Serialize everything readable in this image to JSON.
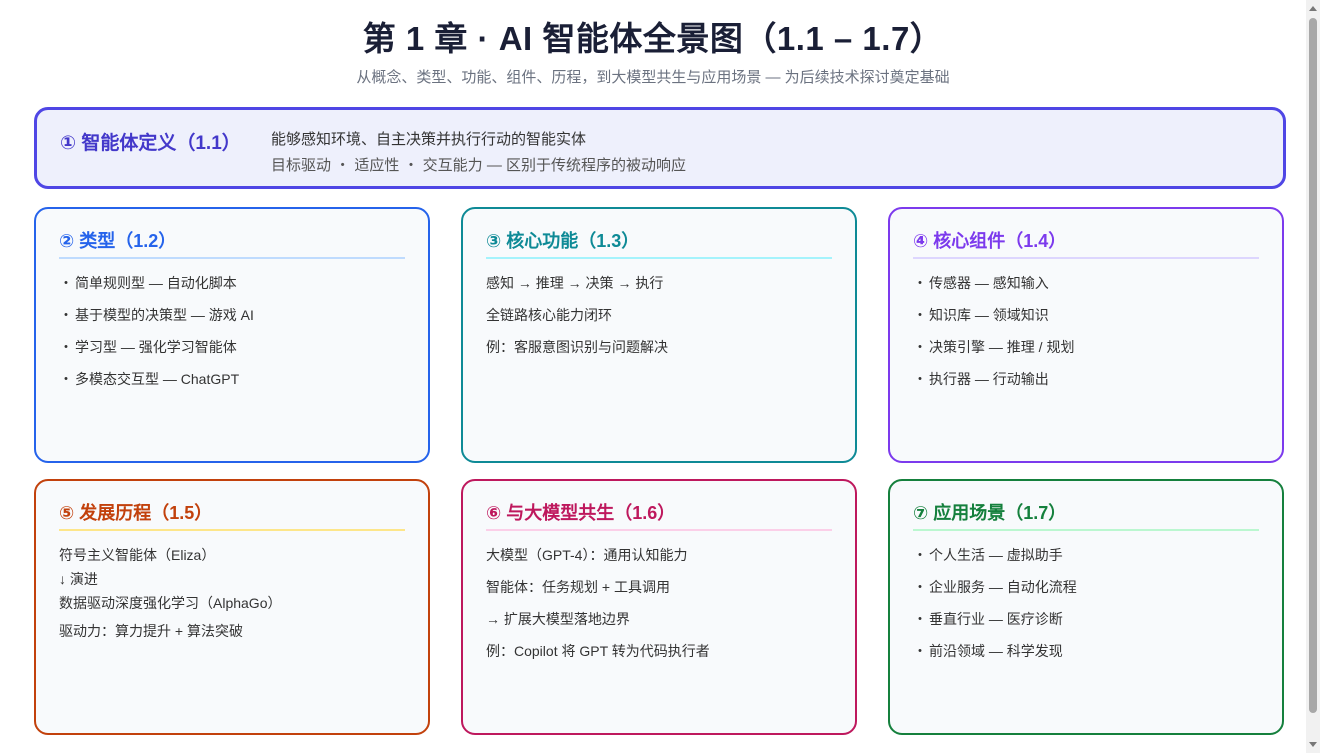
{
  "header": {
    "title": "第 1 章 · AI 智能体全景图（1.1 – 1.7）",
    "subtitle": "从概念、类型、功能、组件、历程，到大模型共生与应用场景 — 为后续技术探讨奠定基础"
  },
  "definition": {
    "title": "① 智能体定义（1.1）",
    "line1": "能够感知环境、自主决策并执行行动的智能实体",
    "line2": "目标驱动 ・ 适应性 ・ 交互能力 — 区别于传统程序的被动响应",
    "color": "#4f46e5"
  },
  "cards": [
    {
      "title": "② 类型（1.2）",
      "color": "#2563eb",
      "rule": "#bfdbfe",
      "items": [
        "简单规则型 — 自动化脚本",
        "基于模型的决策型 — 游戏 AI",
        "学习型 — 强化学习智能体",
        "多模态交互型 — ChatGPT"
      ]
    },
    {
      "title": "③ 核心功能（1.3）",
      "color": "#0e8a96",
      "rule": "#a5f3fc",
      "items": [
        "感知 → 推理 → 决策 → 执行",
        "全链路核心能力闭环",
        "例：客服意图识别与问题解决"
      ]
    },
    {
      "title": "④ 核心组件（1.4）",
      "color": "#7c3aed",
      "rule": "#ddd6fe",
      "items": [
        "传感器 — 感知输入",
        "知识库 — 领域知识",
        "决策引擎 — 推理 / 规划",
        "执行器 — 行动输出"
      ]
    },
    {
      "title": "⑤ 发展历程（1.5）",
      "color": "#c2410c",
      "rule": "#fde68a",
      "items": [
        "符号主义智能体（Eliza）",
        "↓ 演进",
        "数据驱动深度强化学习（AlphaGo）",
        "驱动力：算力提升 + 算法突破"
      ]
    },
    {
      "title": "⑥ 与大模型共生（1.6）",
      "color": "#be185d",
      "rule": "#fbcfe8",
      "items": [
        "大模型（GPT-4）：通用认知能力",
        "智能体：任务规划 + 工具调用",
        "→ 扩展大模型落地边界",
        "例：Copilot 将 GPT 转为代码执行者"
      ]
    },
    {
      "title": "⑦ 应用场景（1.7）",
      "color": "#15803d",
      "rule": "#bbf7d0",
      "items": [
        "个人生活 — 虚拟助手",
        "企业服务 — 自动化流程",
        "垂直行业 — 医疗诊断",
        "前沿领域 — 科学发现"
      ]
    }
  ]
}
